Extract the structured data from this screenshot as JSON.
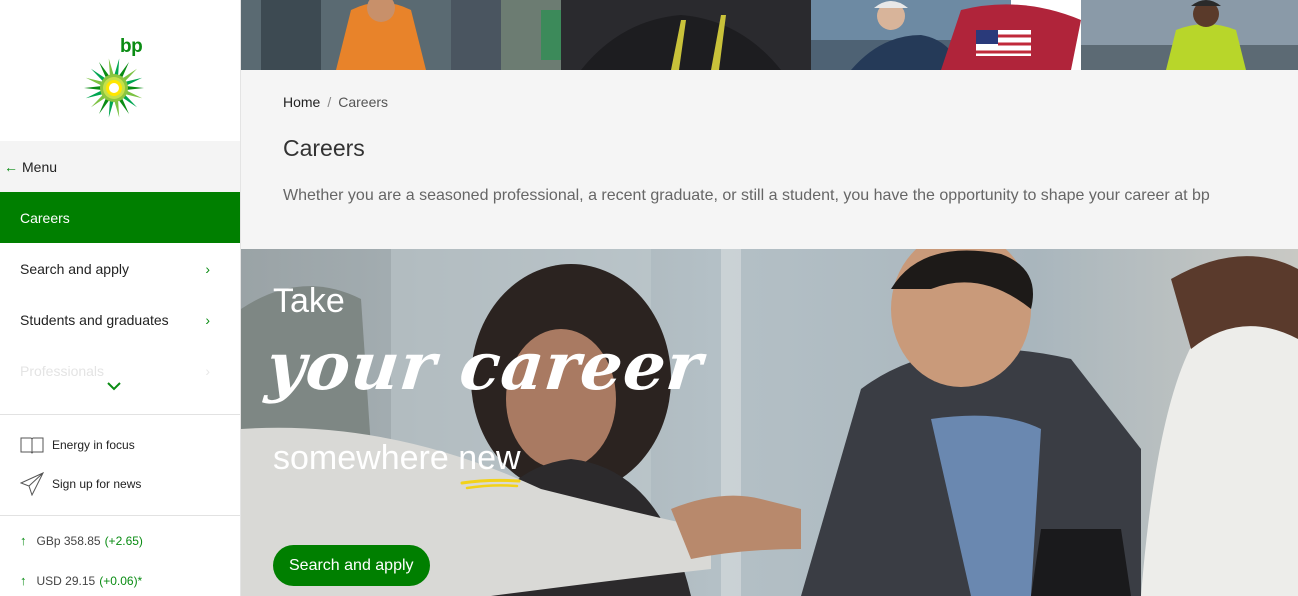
{
  "brand": {
    "logo_text": "bp",
    "primary_color": "#007f00",
    "accent_yellow": "#f2d21a"
  },
  "sidebar": {
    "menu_back_label": "Menu",
    "items": [
      {
        "label": "Careers",
        "active": true
      },
      {
        "label": "Search and apply",
        "has_submenu": true
      },
      {
        "label": "Students and graduates",
        "has_submenu": true
      },
      {
        "label": "Professionals",
        "has_submenu": true
      }
    ],
    "utility_links": [
      {
        "label": "Energy in focus",
        "icon": "book-icon"
      },
      {
        "label": "Sign up for news",
        "icon": "paper-plane-icon"
      }
    ],
    "tickers": [
      {
        "price": "GBp 358.85",
        "change": "(+2.65)"
      },
      {
        "price": "USD 29.15",
        "change": "(+0.06)*"
      }
    ]
  },
  "breadcrumb": {
    "home": "Home",
    "separator": "/",
    "current": "Careers"
  },
  "page": {
    "title": "Careers",
    "description": "Whether you are a seasoned professional, a recent graduate, or still a student, you have the opportunity to shape your career at bp"
  },
  "hero": {
    "line1": "Take",
    "line2": "your career",
    "line3_prefix": "somewhere ",
    "line3_highlight": "new",
    "cta_label": "Search and apply"
  }
}
